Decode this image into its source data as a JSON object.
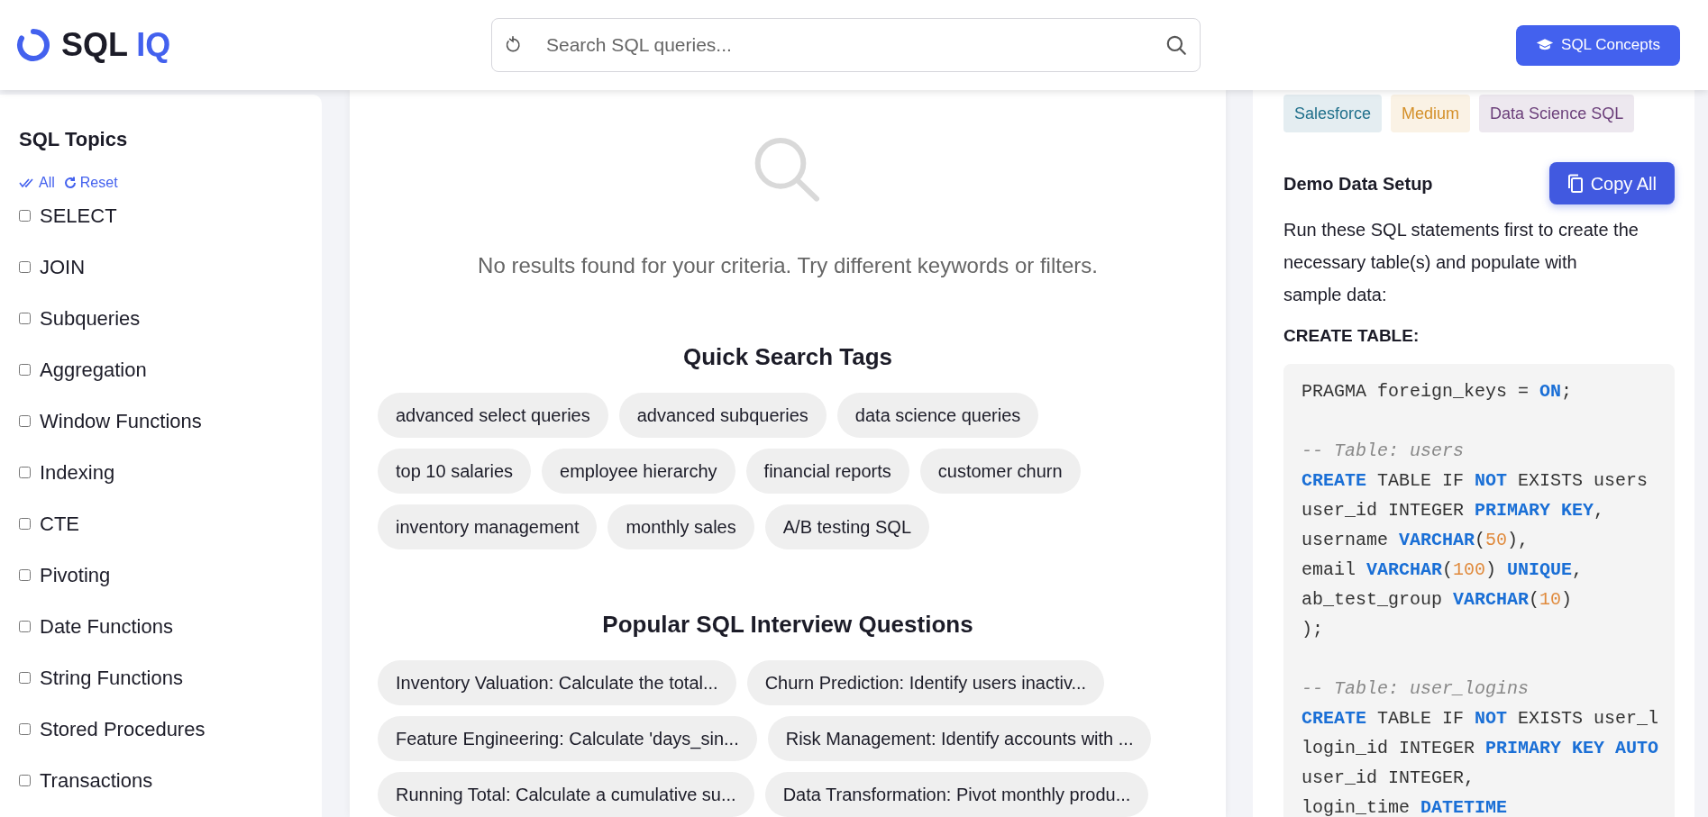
{
  "header": {
    "logo": {
      "primary": "SQL",
      "accent": "IQ"
    },
    "search": {
      "placeholder": "Search SQL queries..."
    },
    "concepts_button": "SQL Concepts"
  },
  "sidebar": {
    "title": "SQL Topics",
    "actions": [
      {
        "kind": "all",
        "label": "All"
      },
      {
        "kind": "reset",
        "label": "Reset"
      }
    ],
    "topics": [
      {
        "label": "SELECT",
        "checked": false
      },
      {
        "label": "JOIN",
        "checked": false
      },
      {
        "label": "Subqueries",
        "checked": false
      },
      {
        "label": "Aggregation",
        "checked": false
      },
      {
        "label": "Window Functions",
        "checked": false
      },
      {
        "label": "Indexing",
        "checked": false
      },
      {
        "label": "CTE",
        "checked": false
      },
      {
        "label": "Pivoting",
        "checked": false
      },
      {
        "label": "Date Functions",
        "checked": false
      },
      {
        "label": "String Functions",
        "checked": false
      },
      {
        "label": "Stored Procedures",
        "checked": false
      },
      {
        "label": "Transactions",
        "checked": false
      }
    ]
  },
  "results": {
    "empty_message": "No results found for your criteria. Try different keywords or filters.",
    "quick_tags_title": "Quick Search Tags",
    "quick_tags": [
      "advanced select queries",
      "advanced subqueries",
      "data science queries",
      "top 10 salaries",
      "employee hierarchy",
      "financial reports",
      "customer churn",
      "inventory management",
      "monthly sales",
      "A/B testing SQL"
    ],
    "popular_title": "Popular SQL Interview Questions",
    "popular_questions": [
      "Inventory Valuation: Calculate the total...",
      "Churn Prediction: Identify users inactiv...",
      "Feature Engineering: Calculate 'days_sin...",
      "Risk Management: Identify accounts with ...",
      "Running Total: Calculate a cumulative su...",
      "Data Transformation: Pivot monthly produ..."
    ]
  },
  "detail": {
    "tags": [
      {
        "label": "Salesforce",
        "color": "#1f6f8b"
      },
      {
        "label": "Medium",
        "color": "#d4902a"
      },
      {
        "label": "Data Science SQL",
        "color": "#6b3f7a"
      }
    ],
    "setup_title": "Demo Data Setup",
    "copy_button": "Copy All",
    "setup_text": "Run these SQL statements first to create the necessary table(s) and populate with sample data:",
    "create_label": "CREATE TABLE:",
    "code_lines": [
      {
        "kind": "code",
        "tokens": [
          {
            "kind": "plain",
            "text": "PRAGMA foreign_keys = "
          },
          {
            "kind": "keyword",
            "text": "ON"
          },
          {
            "kind": "plain",
            "text": ";"
          }
        ]
      },
      {
        "kind": "blank"
      },
      {
        "kind": "code",
        "tokens": [
          {
            "kind": "comment",
            "text": "-- Table: users"
          }
        ]
      },
      {
        "kind": "code",
        "tokens": [
          {
            "kind": "keyword",
            "text": "CREATE"
          },
          {
            "kind": "plain",
            "text": " TABLE IF "
          },
          {
            "kind": "keyword",
            "text": "NOT"
          },
          {
            "kind": "plain",
            "text": " EXISTS users"
          }
        ]
      },
      {
        "kind": "code",
        "tokens": [
          {
            "kind": "plain",
            "text": "user_id INTEGER "
          },
          {
            "kind": "keyword",
            "text": "PRIMARY KEY"
          },
          {
            "kind": "plain",
            "text": ","
          }
        ]
      },
      {
        "kind": "code",
        "tokens": [
          {
            "kind": "plain",
            "text": "username "
          },
          {
            "kind": "keyword",
            "text": "VARCHAR"
          },
          {
            "kind": "plain",
            "text": "("
          },
          {
            "kind": "number",
            "text": "50"
          },
          {
            "kind": "plain",
            "text": "),"
          }
        ]
      },
      {
        "kind": "code",
        "tokens": [
          {
            "kind": "plain",
            "text": "email "
          },
          {
            "kind": "keyword",
            "text": "VARCHAR"
          },
          {
            "kind": "plain",
            "text": "("
          },
          {
            "kind": "number",
            "text": "100"
          },
          {
            "kind": "plain",
            "text": ") "
          },
          {
            "kind": "keyword",
            "text": "UNIQUE"
          },
          {
            "kind": "plain",
            "text": ","
          }
        ]
      },
      {
        "kind": "code",
        "tokens": [
          {
            "kind": "plain",
            "text": "ab_test_group "
          },
          {
            "kind": "keyword",
            "text": "VARCHAR"
          },
          {
            "kind": "plain",
            "text": "("
          },
          {
            "kind": "number",
            "text": "10"
          },
          {
            "kind": "plain",
            "text": ")"
          }
        ]
      },
      {
        "kind": "code",
        "tokens": [
          {
            "kind": "plain",
            "text": ");"
          }
        ]
      },
      {
        "kind": "blank"
      },
      {
        "kind": "code",
        "tokens": [
          {
            "kind": "comment",
            "text": "-- Table: user_logins"
          }
        ]
      },
      {
        "kind": "code",
        "tokens": [
          {
            "kind": "keyword",
            "text": "CREATE"
          },
          {
            "kind": "plain",
            "text": " TABLE IF "
          },
          {
            "kind": "keyword",
            "text": "NOT"
          },
          {
            "kind": "plain",
            "text": " EXISTS user_l"
          }
        ]
      },
      {
        "kind": "code",
        "tokens": [
          {
            "kind": "plain",
            "text": "login_id INTEGER "
          },
          {
            "kind": "keyword",
            "text": "PRIMARY KEY AUTO"
          }
        ]
      },
      {
        "kind": "code",
        "tokens": [
          {
            "kind": "plain",
            "text": "user_id INTEGER,"
          }
        ]
      },
      {
        "kind": "code",
        "tokens": [
          {
            "kind": "plain",
            "text": "login_time "
          },
          {
            "kind": "keyword",
            "text": "DATETIME"
          }
        ]
      }
    ]
  }
}
